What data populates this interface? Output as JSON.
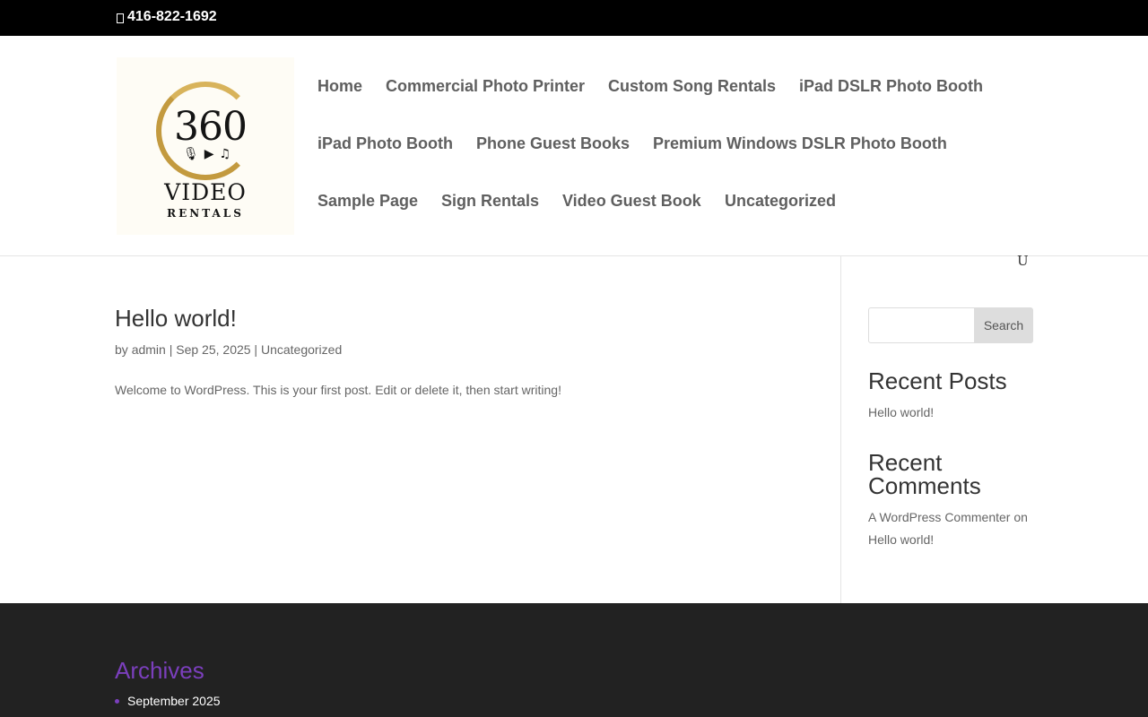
{
  "topbar": {
    "phone": "416-822-1692"
  },
  "logo": {
    "number": "360",
    "word1": "VIDEO",
    "word2": "RENTALS",
    "glyphs": "🎙▶♫"
  },
  "nav": {
    "items": [
      "Home",
      "Commercial Photo Printer",
      "Custom Song Rentals",
      "iPad DSLR Photo Booth",
      "iPad Photo Booth",
      "Phone Guest Books",
      "Premium Windows DSLR Photo Booth",
      "Sample Page",
      "Sign Rentals",
      "Video Guest Book",
      "Uncategorized"
    ],
    "search_glyph": "U"
  },
  "post": {
    "title": "Hello world!",
    "meta_by": "by ",
    "author": "admin",
    "sep1": " | ",
    "date": "Sep 25, 2025",
    "sep2": " | ",
    "category": "Uncategorized",
    "excerpt": "Welcome to WordPress. This is your first post. Edit or delete it, then start writing!"
  },
  "sidebar": {
    "search_button": "Search",
    "recent_posts_heading": "Recent Posts",
    "recent_post": "Hello world!",
    "recent_comments_heading_1": "Recent",
    "recent_comments_heading_2": "Comments",
    "commenter": "A WordPress Commenter",
    "comment_on": " on",
    "comment_post": "Hello world!"
  },
  "footer": {
    "archives_heading": "Archives",
    "archive_item": "September 2025"
  },
  "colors": {
    "accent": "#7b3fbd",
    "gold": "#c39a3f",
    "nav_text": "#5f5f5f"
  }
}
